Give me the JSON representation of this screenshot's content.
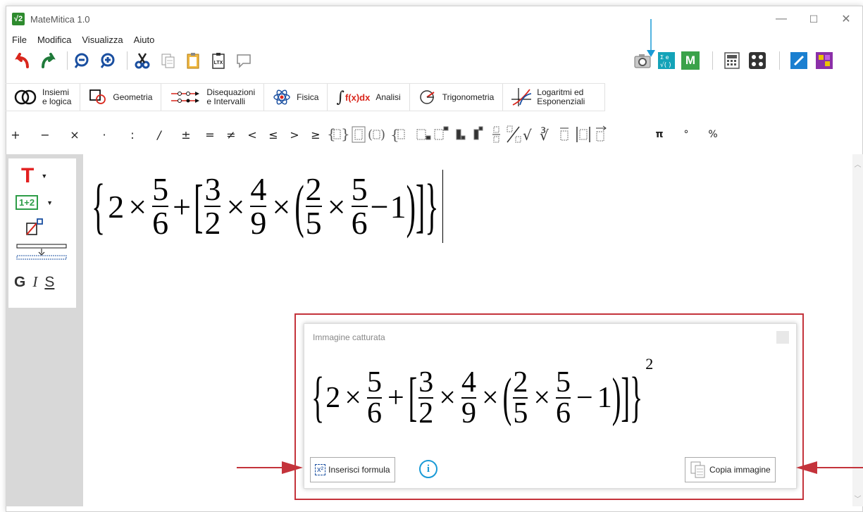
{
  "window": {
    "title": "MateMitica 1.0",
    "logo_text": "√2"
  },
  "window_controls": {
    "minimize": "—",
    "maximize": "☐",
    "close": "✕"
  },
  "menu": [
    "File",
    "Modifica",
    "Visualizza",
    "Aiuto"
  ],
  "toolbar": {
    "undo": "undo-icon",
    "redo": "redo-icon",
    "zoom_out": "zoom-out-icon",
    "zoom_in": "zoom-in-icon",
    "cut": "scissors-icon",
    "copy": "copy-icon",
    "paste": "clipboard-icon",
    "latex_label": "LTX",
    "comment": "comment-icon",
    "camera": "camera-icon",
    "math_doc": "math-doc-icon",
    "m_label": "M",
    "calculator": "calculator-icon",
    "keypad": "keypad-icon",
    "pen": "pen-icon",
    "pattern": "pattern-icon"
  },
  "categories": [
    {
      "label_line1": "Insiemi",
      "label_line2": "e logica"
    },
    {
      "label_line1": "Geometria",
      "label_line2": ""
    },
    {
      "label_line1": "Disequazioni",
      "label_line2": "e Intervalli"
    },
    {
      "label_line1": "Fisica",
      "label_line2": ""
    },
    {
      "label_line1": "Analisi",
      "label_line2": "",
      "prefix": "f(x)dx"
    },
    {
      "label_line1": "Trigonometria",
      "label_line2": ""
    },
    {
      "label_line1": "Logaritmi ed",
      "label_line2": "Esponenziali"
    }
  ],
  "symbols": [
    "+",
    "−",
    "×",
    "·",
    ":",
    "/",
    "±",
    "=",
    "≠",
    "<",
    "≤",
    ">",
    "≥"
  ],
  "symbols_right": [
    "π",
    "°",
    "%"
  ],
  "sidepanel": {
    "text_tool": "T",
    "number_tool": "1+2",
    "bold": "G",
    "italic": "I",
    "underline": "S"
  },
  "formula": {
    "a": "2",
    "f1n": "5",
    "f1d": "6",
    "plus": "+",
    "f2n": "3",
    "f2d": "2",
    "f3n": "4",
    "f3d": "9",
    "f4n": "2",
    "f4d": "5",
    "f5n": "5",
    "f5d": "6",
    "minus": "−",
    "one": "1",
    "times": "×"
  },
  "popup": {
    "title": "Immagine catturata",
    "exponent": "2",
    "insert_icon": "x²",
    "insert_label": "Inserisci formula",
    "info_icon": "i",
    "copy_label": "Copia immagine"
  },
  "colors": {
    "accent_red": "#c4333b",
    "arrow_blue": "#1a9ad6",
    "undo_red": "#d9261c",
    "redo_green": "#1f7a3a",
    "zoom_blue": "#1a4fa0"
  }
}
